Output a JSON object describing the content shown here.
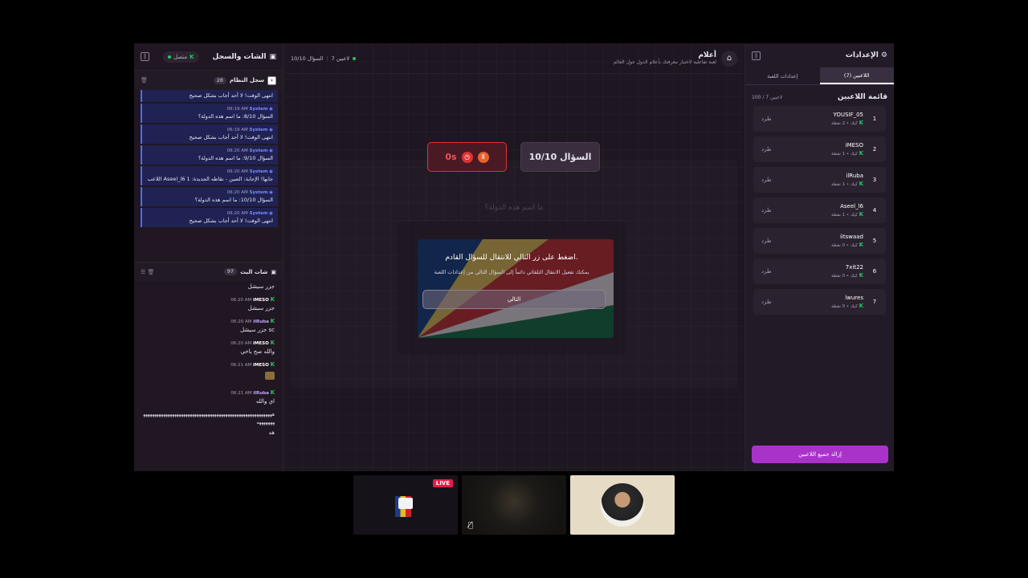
{
  "left": {
    "title": "الشات والسجل",
    "status": "متصل",
    "system_log": {
      "title": "سجل النظام",
      "count": "28",
      "messages": [
        {
          "sender": "System",
          "time": "",
          "text": "انتهى الوقت! لا أحد أجاب بشكل صحيح"
        },
        {
          "sender": "System",
          "time": "06:19 AM",
          "text": "السؤال 8/10: ما اسم هذه الدولة؟"
        },
        {
          "sender": "System",
          "time": "06:19 AM",
          "text": "انتهى الوقت! لا أحد أجاب بشكل صحيح"
        },
        {
          "sender": "System",
          "time": "06:20 AM",
          "text": "السؤال 9/10: ما اسم هذه الدولة؟"
        },
        {
          "sender": "System",
          "time": "06:20 AM",
          "text": "اللاعب Aseel_l6 جابها! الإجابة: الصين - نقاطه الجديدة: 1"
        },
        {
          "sender": "System",
          "time": "06:20 AM",
          "text": "السؤال 10/10: ما اسم هذه الدولة؟"
        },
        {
          "sender": "System",
          "time": "06:20 AM",
          "text": "انتهى الوقت! لا أحد أجاب بشكل صحيح"
        }
      ]
    },
    "chat": {
      "title": "شات البث",
      "count": "97",
      "messages": [
        {
          "user": "",
          "time": "",
          "text": "جزر سيشل"
        },
        {
          "user": "iMESO",
          "time": "06:20 AM",
          "text": "جزر سيشل"
        },
        {
          "user": "ilRuba",
          "time": "06:20 AM",
          "text": "جزر سيشل sc"
        },
        {
          "user": "iMESO",
          "time": "06:20 AM",
          "text": "والله صح ياخي"
        },
        {
          "user": "iMESO",
          "time": "06:21 AM",
          "text": ""
        },
        {
          "user": "ilRuba",
          "time": "06:21 AM",
          "text": "اي والله"
        },
        {
          "user": "",
          "time": "",
          "text": "ههههههههههههههههههههههههههههههههههههههههههههههههههههههههههههههههههه"
        },
        {
          "user": "",
          "time": "",
          "text": "هه"
        }
      ]
    }
  },
  "center": {
    "players_online": "7 لاعبين",
    "question_progress": "السؤال 10/10",
    "game_title": "أعلام",
    "game_subtitle": "لعبة تفاعلية لاختبار معرفتك بأعلام الدول حول العالم",
    "timer": "0s",
    "question_label": "السؤال 10/10",
    "ghost_text": "ما اسم هذه الدولة؟",
    "prompt_main": "اضغط على زر التالي للانتقال للسؤال القادم.",
    "prompt_sub": "يمكنك تفعيل الانتقال التلقائي دائماً إلى السؤال التالي من إعدادات اللعبة",
    "next_button": "التالي"
  },
  "right": {
    "title": "الإعدادات",
    "tabs": [
      "اللاعبين (7)",
      "إعدادات اللعبة"
    ],
    "list_title": "قائمة اللاعبين",
    "list_count": "100 / 7 لاعبين",
    "kick_label": "طرد",
    "players": [
      {
        "rank": "1",
        "name": "YOUSIF_05",
        "sub": "كيك • 2 نقطة"
      },
      {
        "rank": "2",
        "name": "iMESO",
        "sub": "كيك • 1 نقطة"
      },
      {
        "rank": "3",
        "name": "ilRuba",
        "sub": "كيك • 1 نقطة"
      },
      {
        "rank": "4",
        "name": "Aseel_l6",
        "sub": "كيك • 1 نقطة"
      },
      {
        "rank": "5",
        "name": "iitswaad",
        "sub": "كيك • 0 نقطة"
      },
      {
        "rank": "6",
        "name": "7xit22",
        "sub": "كيك • 0 نقطة"
      },
      {
        "rank": "7",
        "name": "lwures",
        "sub": "كيك • 0 نقطة"
      }
    ],
    "remove_all": "إزالة جميع اللاعبين"
  },
  "videos": {
    "live_badge": "LIVE"
  },
  "colors": {
    "accent": "#a933c9",
    "timer_red": "#dd3333",
    "system_blue": "#1f2253"
  }
}
